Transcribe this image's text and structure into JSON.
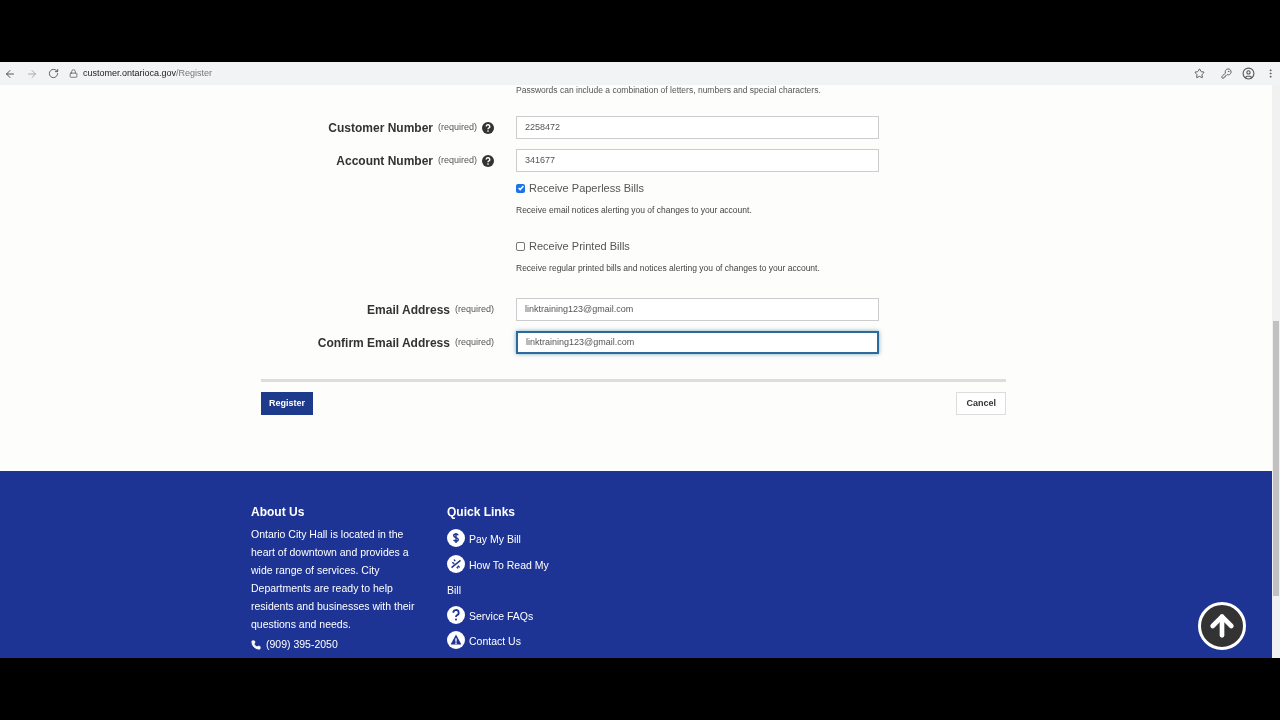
{
  "browser": {
    "url_host": "customer.ontarioca.gov",
    "url_path": "/Register"
  },
  "form": {
    "password_hint": "Passwords can include a combination of letters, numbers and special characters.",
    "fields": [
      {
        "kind": "text",
        "label": "Customer Number",
        "required": "(required)",
        "help": true,
        "value": "2258472",
        "focused": false
      },
      {
        "kind": "text",
        "label": "Account Number",
        "required": "(required)",
        "help": true,
        "value": "341677",
        "focused": false
      },
      {
        "kind": "checkbox",
        "label": "Receive Paperless Bills",
        "checked": true,
        "note": "Receive email notices alerting you of changes to your account."
      },
      {
        "kind": "checkbox",
        "label": "Receive Printed Bills",
        "checked": false,
        "note": "Receive regular printed bills and notices alerting you of changes to your account."
      },
      {
        "kind": "text",
        "label": "Email Address",
        "required": "(required)",
        "help": false,
        "value": "linktraining123@gmail.com",
        "focused": false
      },
      {
        "kind": "text",
        "label": "Confirm Email Address",
        "required": "(required)",
        "help": false,
        "value": "linktraining123@gmail.com",
        "focused": true
      }
    ],
    "buttons": [
      "Register",
      "Cancel"
    ]
  },
  "footer": {
    "about": {
      "title": "About Us",
      "text": "Ontario City Hall is located in the heart of downtown and provides a wide range of services. City Departments are ready to help residents and businesses with their questions and needs.",
      "phone": "(909) 395-2050"
    },
    "quick_links": {
      "title": "Quick Links",
      "links": [
        {
          "kind": "dollar",
          "label": "Pay My Bill"
        },
        {
          "kind": "meter",
          "label": "How To Read My Bill"
        },
        {
          "kind": "question",
          "label": "Service FAQs"
        },
        {
          "kind": "warning",
          "label": "Contact Us"
        }
      ]
    }
  }
}
